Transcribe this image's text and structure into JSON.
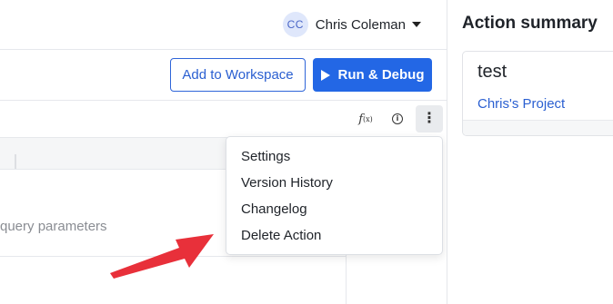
{
  "header": {
    "user": {
      "initials": "CC",
      "name": "Chris Coleman"
    }
  },
  "toolbar": {
    "add_to_workspace_label": "Add to Workspace",
    "run_debug_label": "Run & Debug",
    "fx_label": "f",
    "fx_sub": "(x)",
    "info_glyph": "i",
    "more_glyph": "⋮"
  },
  "editor": {
    "query_params_text": "query parameters"
  },
  "context_menu": {
    "items": [
      {
        "label": "Settings"
      },
      {
        "label": "Version History"
      },
      {
        "label": "Changelog"
      },
      {
        "label": "Delete Action"
      }
    ]
  },
  "action_summary": {
    "title": "Action summary",
    "card": {
      "name": "test",
      "project_link": "Chris's Project"
    }
  },
  "colors": {
    "accent": "#2367e5",
    "annotation_arrow": "#e8303a"
  }
}
